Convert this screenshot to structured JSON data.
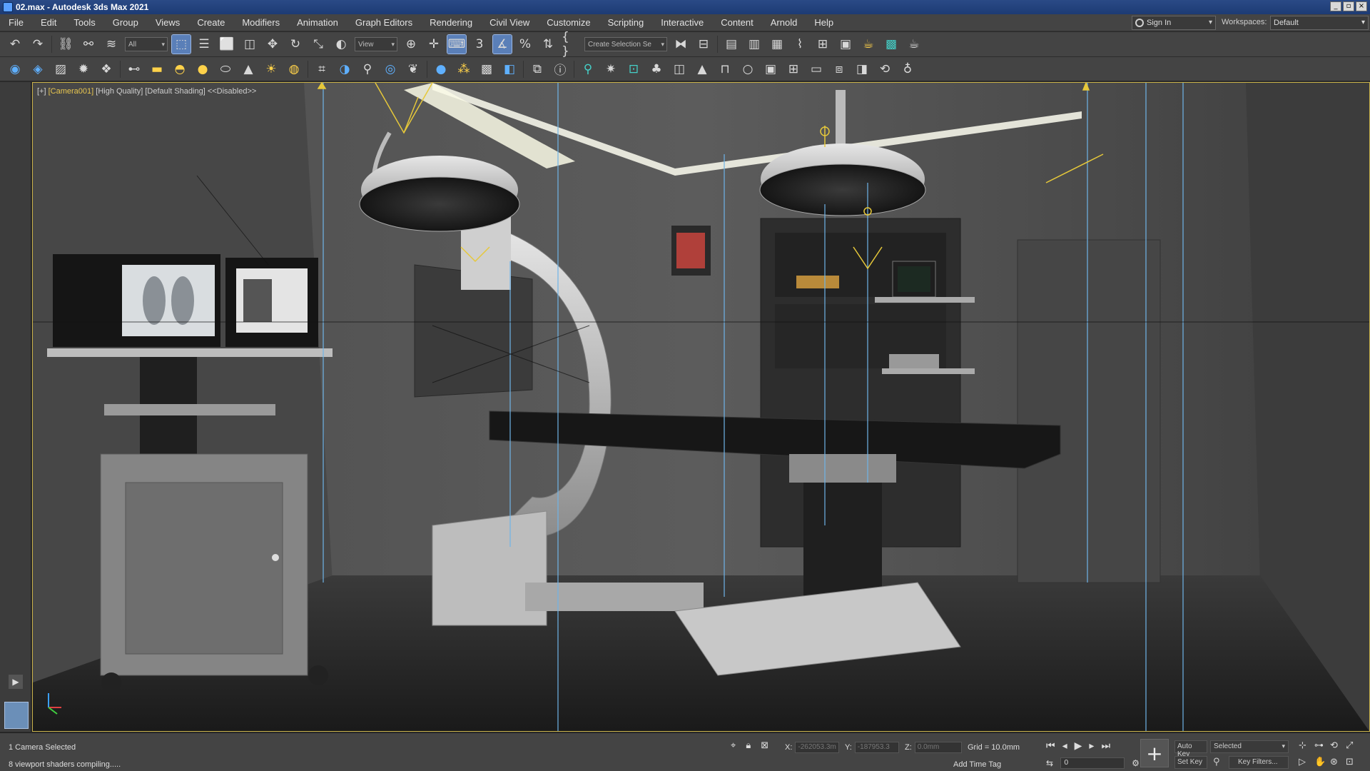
{
  "window": {
    "title": "02.max - Autodesk 3ds Max 2021",
    "controls": [
      "_",
      "▫",
      "×"
    ]
  },
  "menubar": {
    "items": [
      "File",
      "Edit",
      "Tools",
      "Group",
      "Views",
      "Create",
      "Modifiers",
      "Animation",
      "Graph Editors",
      "Rendering",
      "Civil View",
      "Customize",
      "Scripting",
      "Interactive",
      "Content",
      "Arnold",
      "Help"
    ],
    "sign_in": "Sign In",
    "workspaces_label": "Workspaces:",
    "workspace_value": "Default"
  },
  "toolbar1": {
    "selection_filter": "All",
    "reference_coord": "View",
    "create_selection_set": "Create Selection Se"
  },
  "viewport": {
    "label_prefix": "[+]",
    "camera": "[Camera001]",
    "quality": "[High Quality]",
    "shading": "[Default Shading]",
    "state": "<<Disabled>>"
  },
  "statusbar": {
    "selection": "1 Camera Selected",
    "prompt": "8 viewport shaders compiling.....",
    "x_label": "X:",
    "x_value": "-262053.3m",
    "y_label": "Y:",
    "y_value": "-187953.3",
    "z_label": "Z:",
    "z_value": "0.0mm",
    "grid": "Grid = 10.0mm",
    "add_time_tag": "Add Time Tag",
    "auto_key": "Auto Key",
    "set_key": "Set Key",
    "selected": "Selected",
    "key_filters": "Key Filters...",
    "frame": "0"
  },
  "colors": {
    "title_bar": "#1d3b74",
    "ui_panel": "#444444",
    "active_button": "#5a7fb8",
    "camera_label": "#e8c650",
    "viewport_border": "#c9b24a"
  }
}
